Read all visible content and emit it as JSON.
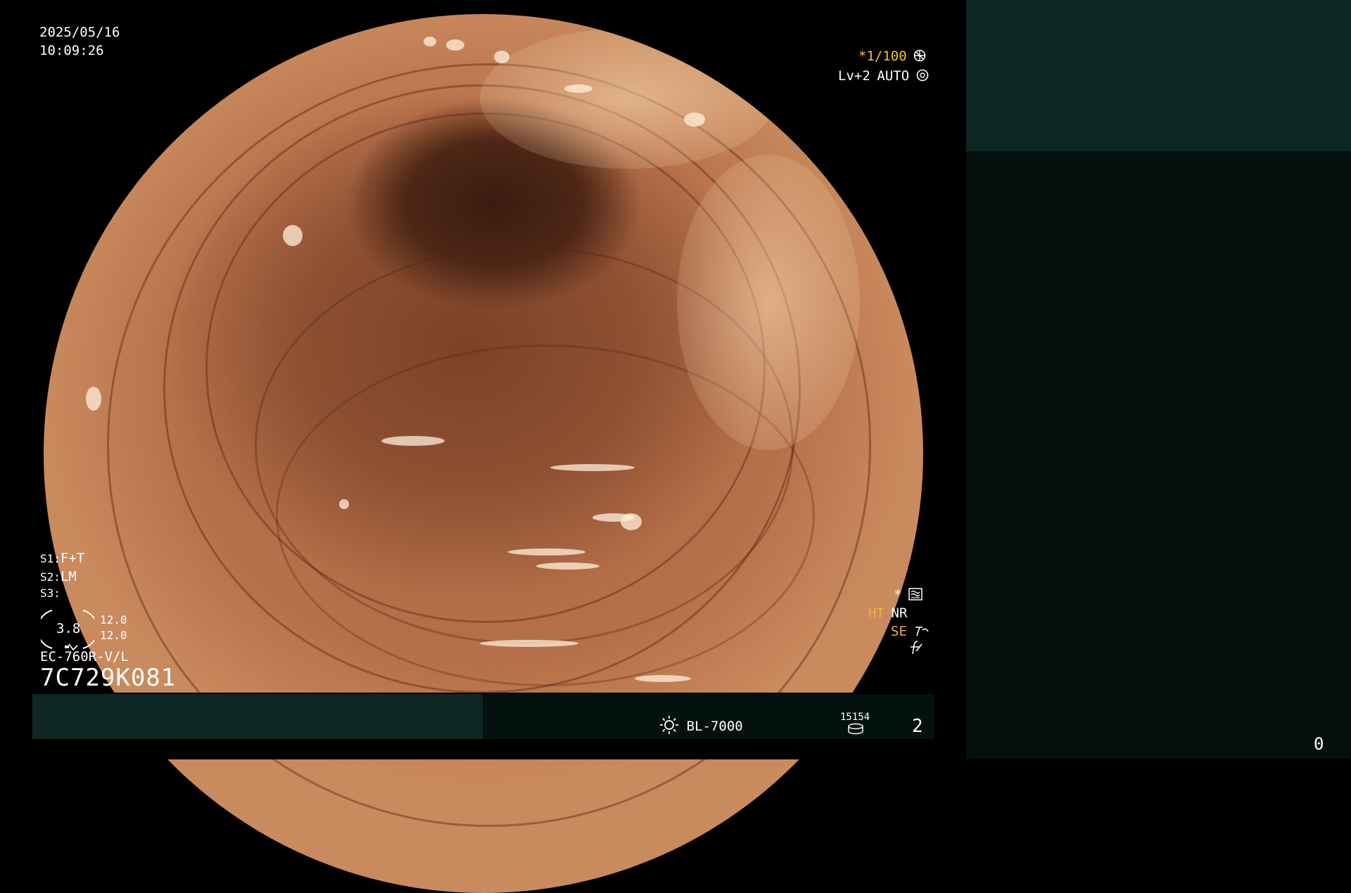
{
  "overlay": {
    "date": "2025/05/16",
    "time": "10:09:26",
    "shutter": "*1/100",
    "level": "Lv+2",
    "iris": "AUTO",
    "s1_label": "S1:",
    "s1_value": "F+T",
    "s2_label": "S2:",
    "s2_value": "LM",
    "s3_label": "S3:",
    "gauge_value": "3.8",
    "gauge_upper": "12.0",
    "gauge_lower": "12.0",
    "scope_model": "EC-760R-V/L",
    "scope_serial": "7C729K081",
    "star": "*",
    "ht": "HT",
    "nr": "NR",
    "se": "SE"
  },
  "statusbar": {
    "light_source": "BL-7000",
    "counter": "15154",
    "page_number": "2"
  },
  "right_panel": {
    "count": "0"
  },
  "colors": {
    "background": "#000000",
    "panel_dark": "#030f0d",
    "panel_teal": "#0d2824",
    "accent_yellow": "#f2c239",
    "text": "#ffffff"
  }
}
